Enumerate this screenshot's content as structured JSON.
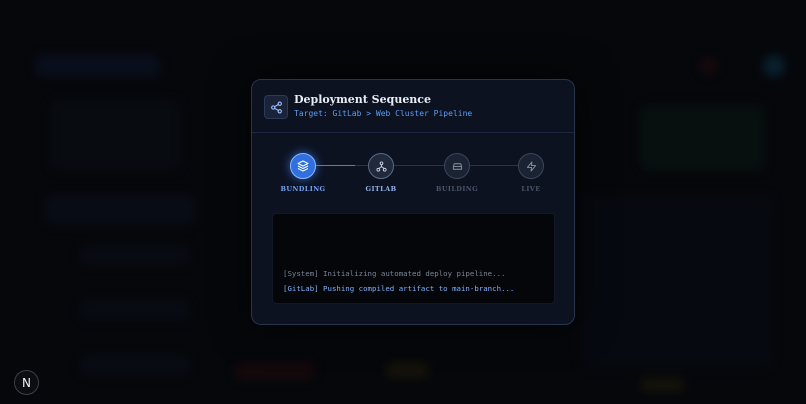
{
  "modal": {
    "title": "Deployment Sequence",
    "subtitle": "Target: GitLab > Web Cluster Pipeline",
    "icon": "share-icon"
  },
  "steps": [
    {
      "label": "BUNDLING",
      "icon": "layers-icon",
      "state": "active"
    },
    {
      "label": "GITLAB",
      "icon": "git-branch-icon",
      "state": "done"
    },
    {
      "label": "BUILDING",
      "icon": "box-icon",
      "state": "pending"
    },
    {
      "label": "LIVE",
      "icon": "bolt-icon",
      "state": "pending"
    }
  ],
  "console": {
    "lines": [
      "[System] Initializing automated deploy pipeline...",
      "[GitLab] Pushing compiled artifact to main-branch..."
    ]
  },
  "corner_logo": {
    "glyph": "N"
  },
  "colors": {
    "accent": "#3b82f6",
    "background": "#07090d",
    "modal": "#0c1220"
  }
}
